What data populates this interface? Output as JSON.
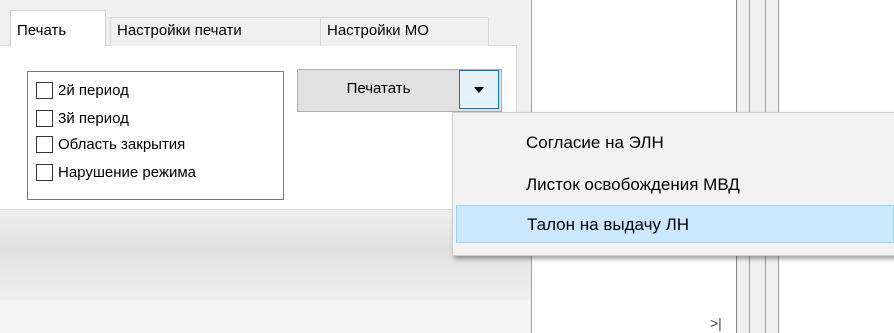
{
  "tabs": [
    {
      "label": "Печать",
      "active": true
    },
    {
      "label": "Настройки печати",
      "active": false
    },
    {
      "label": "Настройки МО",
      "active": false
    }
  ],
  "checkboxes": [
    {
      "label": "2й период",
      "checked": false
    },
    {
      "label": "3й период",
      "checked": false
    },
    {
      "label": "Область закрытия",
      "checked": false
    },
    {
      "label": "Нарушение режима",
      "checked": false
    }
  ],
  "print_button": {
    "label": "Печатать",
    "dropdown_icon": "chevron-down-icon"
  },
  "menu": {
    "items": [
      {
        "label": "Согласие на ЭЛН",
        "highlighted": false
      },
      {
        "label": "Листок освобождения МВД",
        "highlighted": false
      },
      {
        "label": "Талон на выдачу ЛН",
        "highlighted": true
      }
    ]
  },
  "colors": {
    "highlight": "#cce8ff",
    "highlight_border": "#99d1ff",
    "dropdown_accent": "#0078d7"
  },
  "bottom_mark": ">|"
}
